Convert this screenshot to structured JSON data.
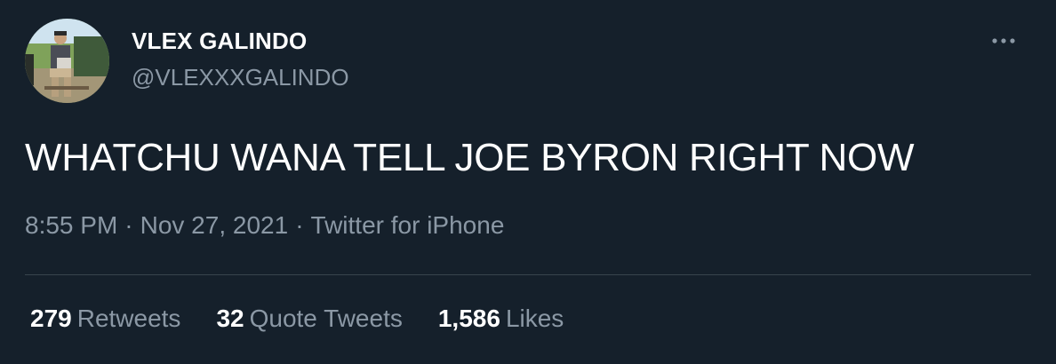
{
  "user": {
    "display_name": "VLEX GALINDO",
    "handle": "@VLEXXXGALINDO",
    "avatar_icon": "profile-photo"
  },
  "menu": {
    "more_icon": "more-horizontal-icon"
  },
  "tweet": {
    "text": "WHATCHU WANA TELL JOE BYRON RIGHT NOW",
    "time": "8:55 PM",
    "date": "Nov 27, 2021",
    "source": "Twitter for iPhone",
    "separator": "·"
  },
  "stats": [
    {
      "count": "279",
      "label": "Retweets"
    },
    {
      "count": "32",
      "label": "Quote Tweets"
    },
    {
      "count": "1,586",
      "label": "Likes"
    }
  ],
  "colors": {
    "background": "#15202b",
    "text_primary": "#ffffff",
    "text_secondary": "#8b98a5",
    "divider": "#38444d"
  }
}
